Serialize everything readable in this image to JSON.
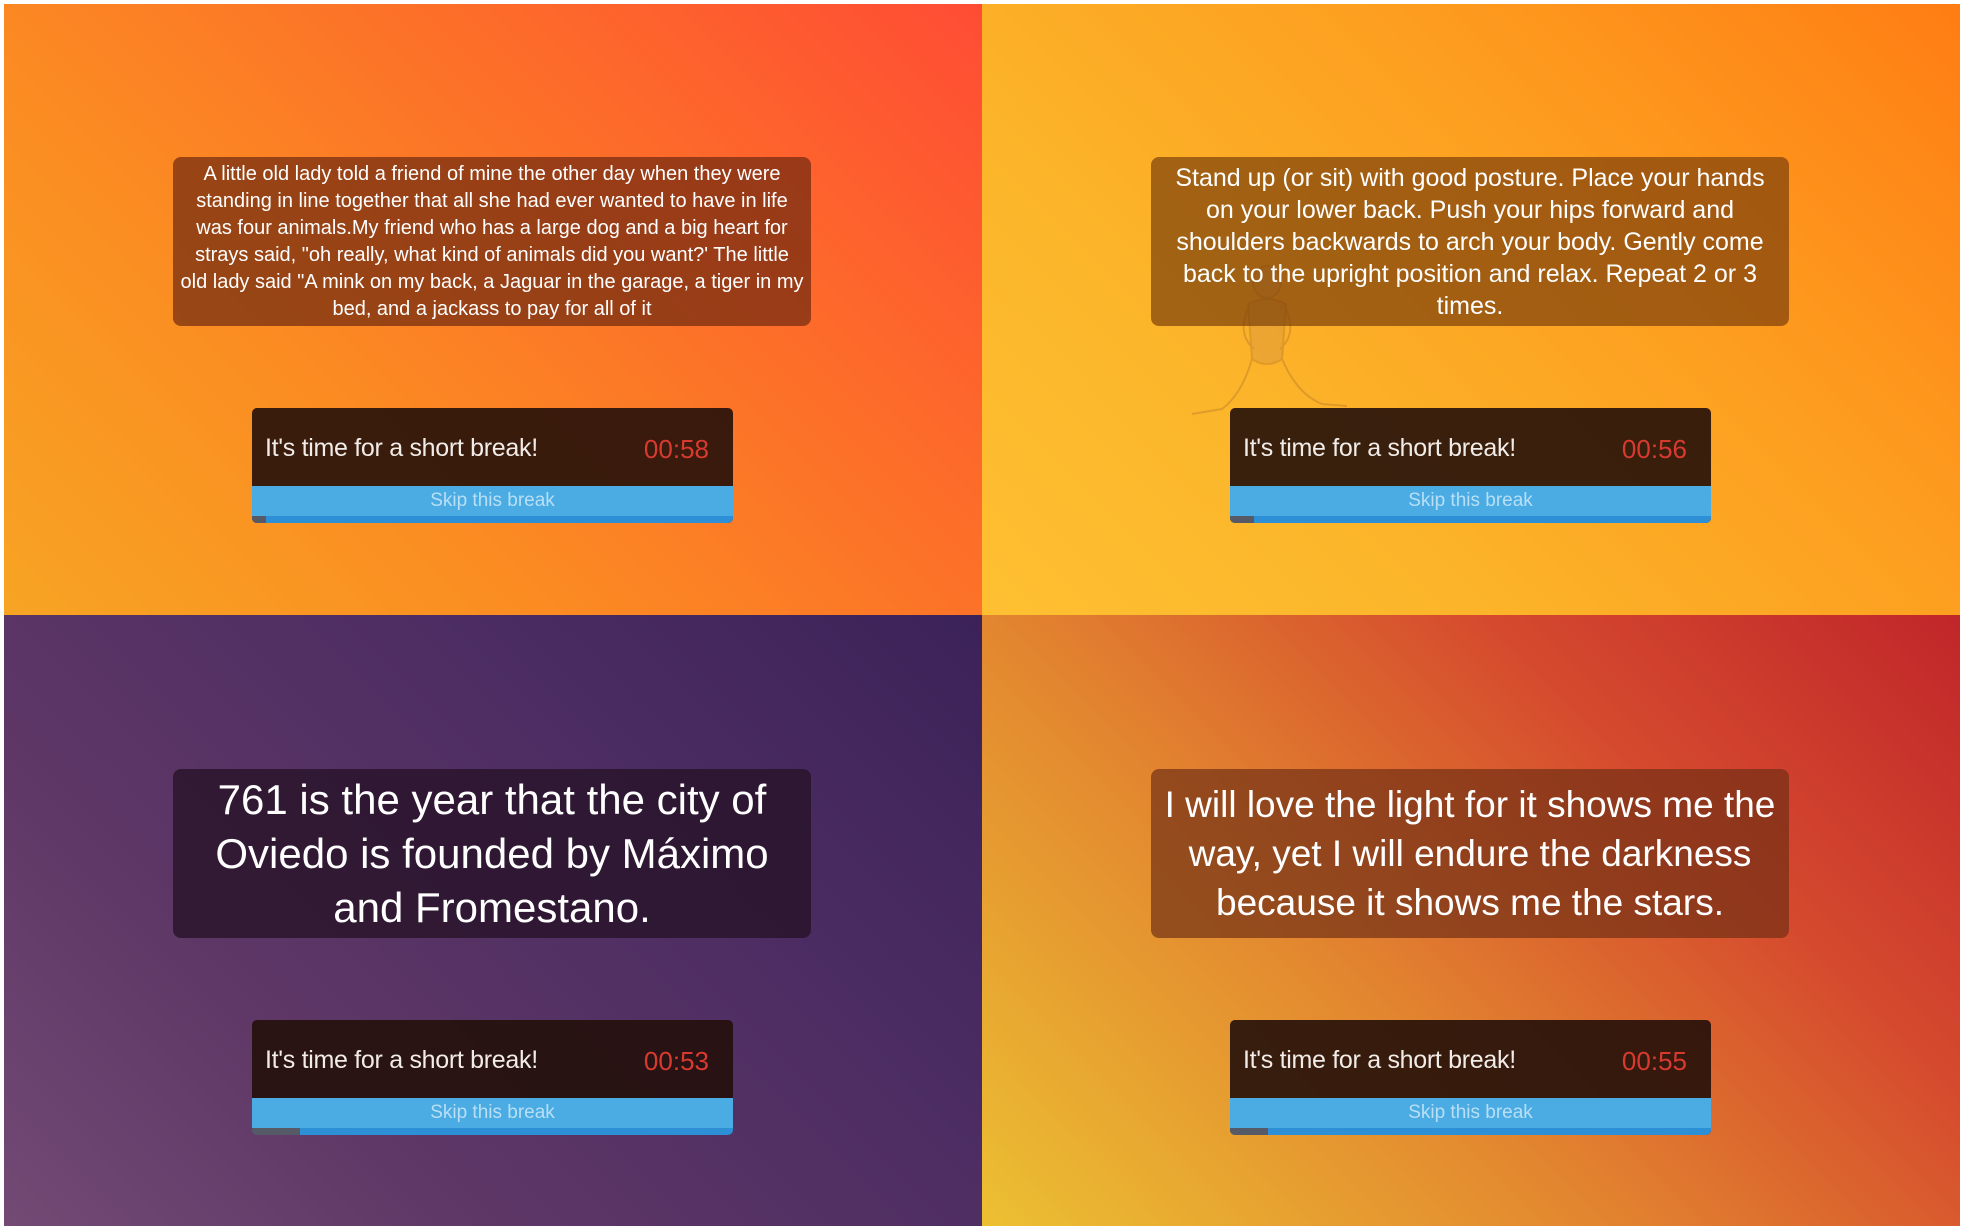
{
  "panels": [
    {
      "message": "A little old lady told a friend of mine the other day when they were standing in line together that all she had ever wanted to have in life was four animals.My friend who has a large dog and a big heart for strays said, \"oh really, what kind of animals did you want?' The little old lady said \"A mink on my back, a Jaguar in the garage, a tiger in my bed, and a jackass to pay for all of it",
      "break_label": "It's time for a short break!",
      "timer": "00:58",
      "skip_label": "Skip this break",
      "progress": 0.03
    },
    {
      "message": "Stand up (or sit) with good posture. Place your hands on your lower back. Push your hips forward and shoulders backwards to arch your body. Gently come back to the upright position and relax. Repeat 2 or 3 times.",
      "break_label": "It's time for a short break!",
      "timer": "00:56",
      "skip_label": "Skip this break",
      "progress": 0.05
    },
    {
      "message": "761 is the year that the city of Oviedo is founded by Máximo and Fromestano.",
      "break_label": "It's time for a short break!",
      "timer": "00:53",
      "skip_label": "Skip this break",
      "progress": 0.1
    },
    {
      "message": "I will love the light for it shows me the way, yet I will endure the darkness because it shows me the stars.",
      "break_label": "It's time for a short break!",
      "timer": "00:55",
      "skip_label": "Skip this break",
      "progress": 0.08
    }
  ],
  "colors": {
    "timer": "#d93a30",
    "skip_button": "#4aace3",
    "progress_track": "#2d8fd6",
    "progress_fill": "#555a66"
  },
  "icons": {
    "exercise_illustration": "back-stretch-pose-icon"
  }
}
